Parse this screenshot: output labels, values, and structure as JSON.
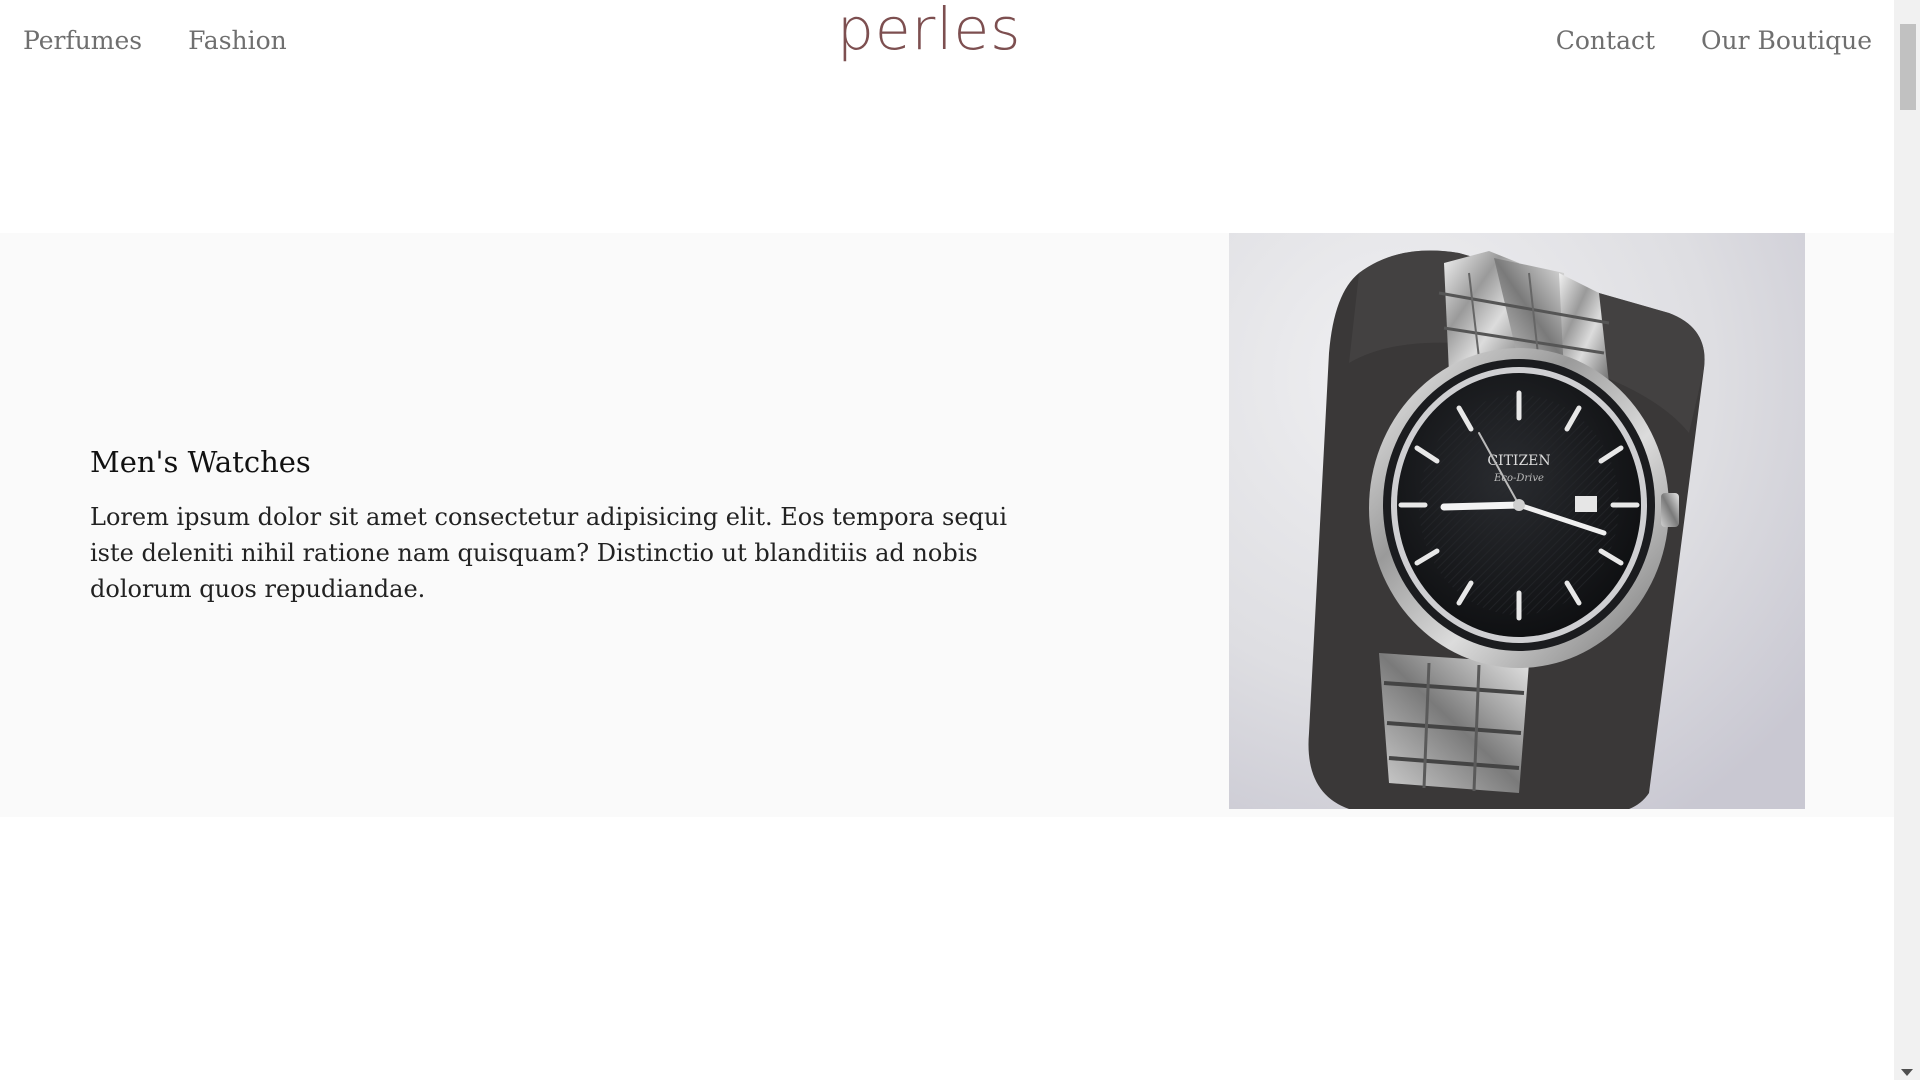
{
  "header": {
    "logo": "perles",
    "nav_left": [
      {
        "label": "Perfumes"
      },
      {
        "label": "Fashion"
      }
    ],
    "nav_right": [
      {
        "label": "Contact"
      },
      {
        "label": "Our Boutique"
      }
    ]
  },
  "feature": {
    "title": "Men's Watches",
    "description": "Lorem ipsum dolor sit amet consectetur adipisicing elit. Eos tempora sequi iste deleniti nihil ratione nam quisquam? Distinctio ut blanditiis ad nobis dolorum quos repudiandae.",
    "image": {
      "subject": "silver wristwatch on dark cushion",
      "brand_text": "CITIZEN",
      "sub_text": "Eco-Drive"
    }
  },
  "colors": {
    "logo": "#7d4f50",
    "nav_text": "#6f6f6f",
    "section_bg": "#fafafa"
  }
}
